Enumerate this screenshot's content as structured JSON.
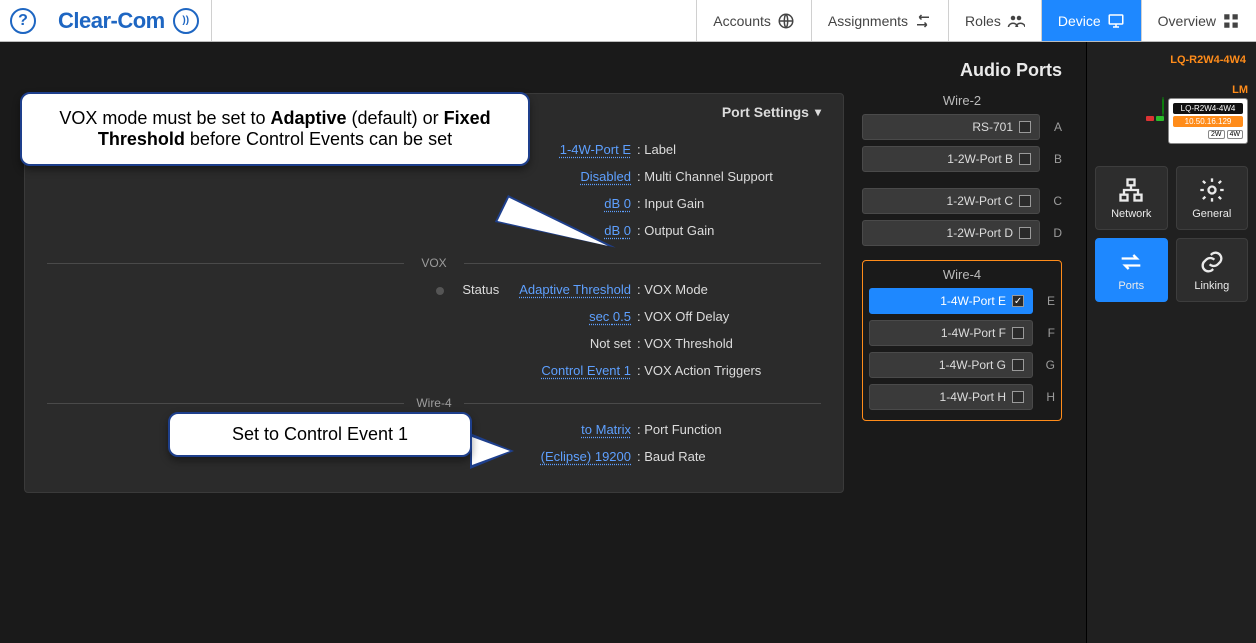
{
  "nav": {
    "overview": "Overview",
    "device": "Device",
    "roles": "Roles",
    "assignments": "Assignments",
    "accounts": "Accounts"
  },
  "brand": {
    "name": "Clear-Com"
  },
  "help_glyph": "?",
  "sidebar": {
    "device_model": "LQ-R2W4-4W4",
    "lm": "LM",
    "card": {
      "name": "LQ-R2W4-4W4",
      "ip": "10.50.16.129",
      "tag_a": "4W",
      "tag_b": "2W"
    },
    "tiles": {
      "general": "General",
      "network": "Network",
      "linking": "Linking",
      "ports": "Ports"
    }
  },
  "page": {
    "title": "Audio Ports",
    "group_2wire": "2-Wire",
    "group_4wire": "4-Wire",
    "ports2": [
      {
        "letter": "A",
        "label": "RS-701",
        "checked": false
      },
      {
        "letter": "B",
        "label": "1-2W-Port B",
        "checked": false
      },
      {
        "letter": "C",
        "label": "1-2W-Port C",
        "checked": false
      },
      {
        "letter": "D",
        "label": "1-2W-Port D",
        "checked": false
      }
    ],
    "ports4": [
      {
        "letter": "E",
        "label": "1-4W-Port E",
        "checked": true,
        "selected": true
      },
      {
        "letter": "F",
        "label": "1-4W-Port F",
        "checked": false
      },
      {
        "letter": "G",
        "label": "1-4W-Port G",
        "checked": false
      },
      {
        "letter": "H",
        "label": "1-4W-Port H",
        "checked": false
      }
    ],
    "settings": {
      "header": "Port Settings",
      "label": {
        "k": "Label :",
        "v": "1-4W-Port E"
      },
      "mcs": {
        "k": "Multi Channel Support :",
        "v": "Disabled"
      },
      "igain": {
        "k": "Input Gain :",
        "v": "0 dB"
      },
      "ogain": {
        "k": "Output Gain :",
        "v": "0 dB"
      },
      "sec_vox": "VOX",
      "voxmode": {
        "k": "VOX Mode :",
        "v": "Adaptive Threshold",
        "status": "Status"
      },
      "voxoff": {
        "k": "VOX Off Delay :",
        "v": "0.5 sec"
      },
      "voxthr": {
        "k": "VOX Threshold :",
        "v": "Not set"
      },
      "voxact": {
        "k": "VOX Action Triggers :",
        "v": "Control Event 1"
      },
      "sec_4w": "4-Wire",
      "pfunc": {
        "k": "Port Function :",
        "v": "to Matrix"
      },
      "baud": {
        "k": "Baud Rate :",
        "v": "19200 (Eclipse)"
      }
    }
  },
  "callouts": {
    "c1_a": "VOX mode must be set to ",
    "c1_b": "Adaptive",
    "c1_c": " (default) or ",
    "c1_d": "Fixed Threshold",
    "c1_e": " before Control Events can be set",
    "c2": "Set to Control Event 1"
  }
}
